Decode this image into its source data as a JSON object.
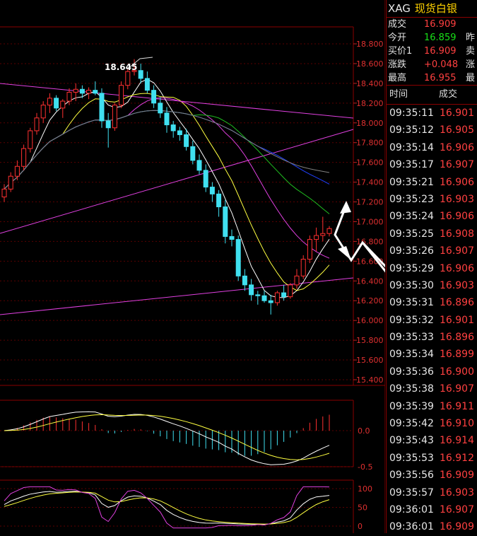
{
  "header": {
    "code": "XAG",
    "name": "现货白银"
  },
  "quote": [
    {
      "label": "成交",
      "value": "16.909",
      "color": "#ff4040",
      "extra": ""
    },
    {
      "label": "今开",
      "value": "16.859",
      "color": "#18e018",
      "extra": "昨"
    },
    {
      "label": "买价1",
      "value": "16.909",
      "color": "#ff4040",
      "extra": "卖"
    },
    {
      "label": "涨跌",
      "value": "+0.048",
      "color": "#ff4040",
      "extra": "涨"
    },
    {
      "label": "最高",
      "value": "16.955",
      "color": "#ff4040",
      "extra": "最"
    }
  ],
  "tick_header": {
    "time": "时间",
    "price": "成交"
  },
  "ticks": [
    {
      "time": "09:35:11",
      "price": "16.901"
    },
    {
      "time": "09:35:12",
      "price": "16.905"
    },
    {
      "time": "09:35:14",
      "price": "16.906"
    },
    {
      "time": "09:35:17",
      "price": "16.907"
    },
    {
      "time": "09:35:21",
      "price": "16.906"
    },
    {
      "time": "09:35:23",
      "price": "16.903"
    },
    {
      "time": "09:35:24",
      "price": "16.906"
    },
    {
      "time": "09:35:25",
      "price": "16.908"
    },
    {
      "time": "09:35:26",
      "price": "16.907"
    },
    {
      "time": "09:35:29",
      "price": "16.906"
    },
    {
      "time": "09:35:30",
      "price": "16.903"
    },
    {
      "time": "09:35:31",
      "price": "16.896"
    },
    {
      "time": "09:35:32",
      "price": "16.901"
    },
    {
      "time": "09:35:33",
      "price": "16.896"
    },
    {
      "time": "09:35:34",
      "price": "16.899"
    },
    {
      "time": "09:35:36",
      "price": "16.900"
    },
    {
      "time": "09:35:38",
      "price": "16.907"
    },
    {
      "time": "09:35:39",
      "price": "16.911"
    },
    {
      "time": "09:35:42",
      "price": "16.910"
    },
    {
      "time": "09:35:43",
      "price": "16.914"
    },
    {
      "time": "09:35:53",
      "price": "16.912"
    },
    {
      "time": "09:35:56",
      "price": "16.909"
    },
    {
      "time": "09:35:57",
      "price": "16.903"
    },
    {
      "time": "09:36:01",
      "price": "16.907"
    },
    {
      "time": "09:36:01",
      "price": "16.909"
    }
  ],
  "chart_data": {
    "type": "candlestick",
    "price_axis": {
      "ticks": [
        "18.800",
        "18.600",
        "18.400",
        "18.200",
        "18.000",
        "17.800",
        "17.600",
        "17.400",
        "17.200",
        "17.000",
        "16.800",
        "16.600",
        "16.400",
        "16.200",
        "16.000",
        "15.800",
        "15.600",
        "15.400"
      ],
      "range": [
        15.4,
        18.85
      ]
    },
    "high_label": "18.645",
    "macd_axis": {
      "ticks": [
        "0.0",
        "-0.5"
      ]
    },
    "kdj_axis": {
      "ticks": [
        "100",
        "50",
        "0"
      ]
    },
    "candles": [
      {
        "o": 17.25,
        "h": 17.38,
        "l": 17.2,
        "c": 17.33
      },
      {
        "o": 17.33,
        "h": 17.5,
        "l": 17.3,
        "c": 17.46
      },
      {
        "o": 17.46,
        "h": 17.62,
        "l": 17.42,
        "c": 17.56
      },
      {
        "o": 17.56,
        "h": 17.78,
        "l": 17.52,
        "c": 17.74
      },
      {
        "o": 17.74,
        "h": 17.95,
        "l": 17.7,
        "c": 17.92
      },
      {
        "o": 17.92,
        "h": 18.1,
        "l": 17.88,
        "c": 18.05
      },
      {
        "o": 18.05,
        "h": 18.22,
        "l": 18.0,
        "c": 18.18
      },
      {
        "o": 18.18,
        "h": 18.3,
        "l": 18.1,
        "c": 18.25
      },
      {
        "o": 18.25,
        "h": 18.28,
        "l": 18.12,
        "c": 18.15
      },
      {
        "o": 18.15,
        "h": 18.24,
        "l": 18.05,
        "c": 18.22
      },
      {
        "o": 18.22,
        "h": 18.35,
        "l": 18.18,
        "c": 18.31
      },
      {
        "o": 18.31,
        "h": 18.4,
        "l": 18.22,
        "c": 18.34
      },
      {
        "o": 18.34,
        "h": 18.38,
        "l": 18.25,
        "c": 18.3
      },
      {
        "o": 18.3,
        "h": 18.36,
        "l": 18.24,
        "c": 18.33
      },
      {
        "o": 18.33,
        "h": 18.42,
        "l": 18.28,
        "c": 18.3
      },
      {
        "o": 18.3,
        "h": 18.35,
        "l": 17.95,
        "c": 18.02
      },
      {
        "o": 18.02,
        "h": 18.1,
        "l": 17.75,
        "c": 17.95
      },
      {
        "o": 17.95,
        "h": 18.2,
        "l": 17.92,
        "c": 18.18
      },
      {
        "o": 18.18,
        "h": 18.42,
        "l": 18.15,
        "c": 18.38
      },
      {
        "o": 18.38,
        "h": 18.55,
        "l": 18.34,
        "c": 18.52
      },
      {
        "o": 18.52,
        "h": 18.645,
        "l": 18.48,
        "c": 18.53
      },
      {
        "o": 18.53,
        "h": 18.6,
        "l": 18.4,
        "c": 18.45
      },
      {
        "o": 18.45,
        "h": 18.52,
        "l": 18.3,
        "c": 18.33
      },
      {
        "o": 18.33,
        "h": 18.38,
        "l": 18.15,
        "c": 18.2
      },
      {
        "o": 18.2,
        "h": 18.26,
        "l": 18.05,
        "c": 18.1
      },
      {
        "o": 18.1,
        "h": 18.16,
        "l": 17.9,
        "c": 17.98
      },
      {
        "o": 17.98,
        "h": 18.02,
        "l": 17.85,
        "c": 17.92
      },
      {
        "o": 17.92,
        "h": 17.96,
        "l": 17.82,
        "c": 17.88
      },
      {
        "o": 17.88,
        "h": 17.94,
        "l": 17.72,
        "c": 17.76
      },
      {
        "o": 17.76,
        "h": 17.82,
        "l": 17.58,
        "c": 17.62
      },
      {
        "o": 17.62,
        "h": 17.68,
        "l": 17.48,
        "c": 17.52
      },
      {
        "o": 17.52,
        "h": 17.58,
        "l": 17.3,
        "c": 17.35
      },
      {
        "o": 17.35,
        "h": 17.4,
        "l": 17.2,
        "c": 17.28
      },
      {
        "o": 17.28,
        "h": 17.32,
        "l": 17.05,
        "c": 17.15
      },
      {
        "o": 17.15,
        "h": 17.22,
        "l": 16.78,
        "c": 16.85
      },
      {
        "o": 16.85,
        "h": 16.92,
        "l": 16.75,
        "c": 16.82
      },
      {
        "o": 16.82,
        "h": 16.86,
        "l": 16.4,
        "c": 16.45
      },
      {
        "o": 16.45,
        "h": 16.52,
        "l": 16.3,
        "c": 16.36
      },
      {
        "o": 16.36,
        "h": 16.42,
        "l": 16.2,
        "c": 16.26
      },
      {
        "o": 16.26,
        "h": 16.3,
        "l": 16.16,
        "c": 16.25
      },
      {
        "o": 16.25,
        "h": 16.3,
        "l": 16.18,
        "c": 16.2
      },
      {
        "o": 16.2,
        "h": 16.26,
        "l": 16.06,
        "c": 16.18
      },
      {
        "o": 16.18,
        "h": 16.3,
        "l": 16.15,
        "c": 16.28
      },
      {
        "o": 16.28,
        "h": 16.36,
        "l": 16.2,
        "c": 16.24
      },
      {
        "o": 16.24,
        "h": 16.38,
        "l": 16.22,
        "c": 16.36
      },
      {
        "o": 16.36,
        "h": 16.52,
        "l": 16.32,
        "c": 16.45
      },
      {
        "o": 16.45,
        "h": 16.66,
        "l": 16.42,
        "c": 16.62
      },
      {
        "o": 16.62,
        "h": 16.86,
        "l": 16.58,
        "c": 16.82
      },
      {
        "o": 16.82,
        "h": 16.94,
        "l": 16.7,
        "c": 16.86
      },
      {
        "o": 16.86,
        "h": 17.05,
        "l": 16.8,
        "c": 16.88
      },
      {
        "o": 16.88,
        "h": 16.955,
        "l": 16.85,
        "c": 16.93
      }
    ]
  }
}
